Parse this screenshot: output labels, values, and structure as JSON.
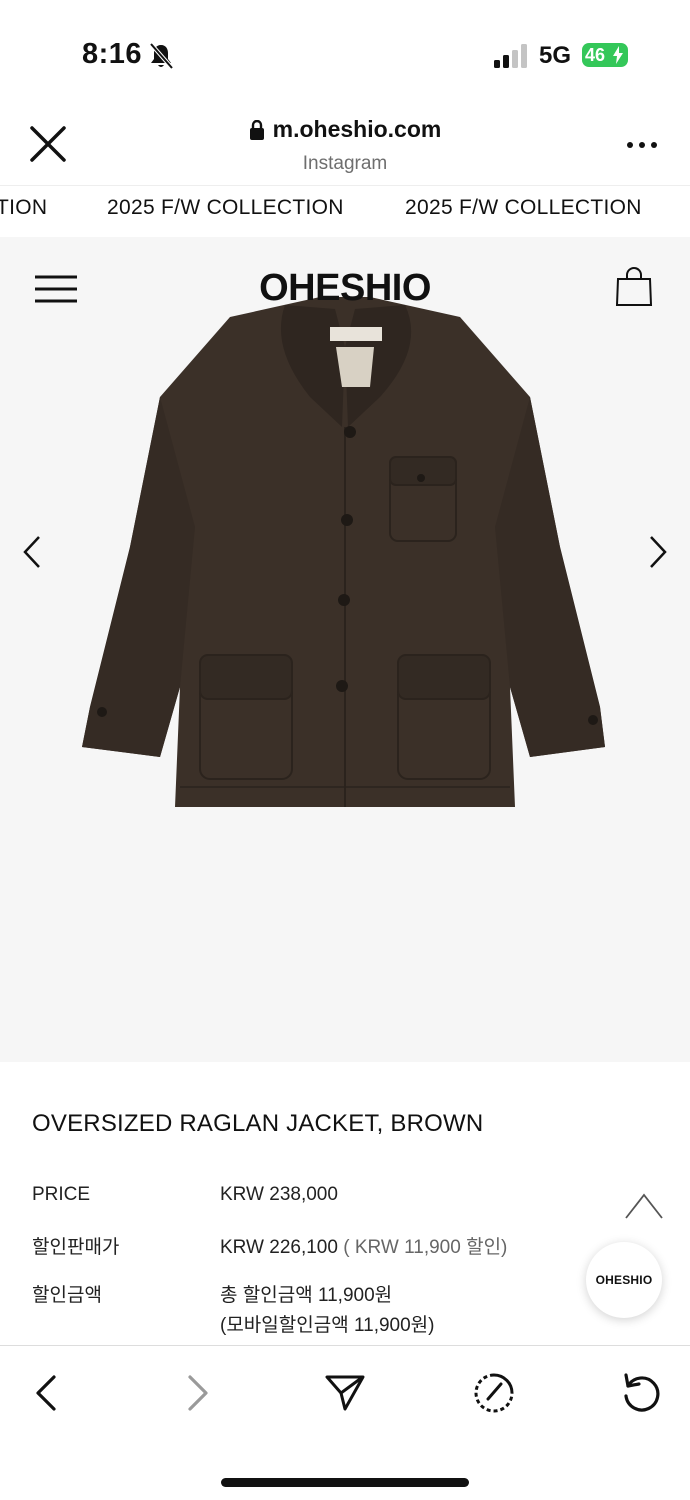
{
  "status_bar": {
    "time": "8:16",
    "network": "5G",
    "battery": "46",
    "icons": [
      "bell-slash-icon",
      "signal-icon",
      "battery-charging-icon"
    ]
  },
  "browser": {
    "url": "m.oheshio.com",
    "source": "Instagram",
    "icons": [
      "close-icon",
      "lock-icon",
      "more-icon"
    ]
  },
  "marquee": {
    "items": [
      "TION",
      "2025 F/W COLLECTION",
      "2025 F/W COLLECTION"
    ]
  },
  "site_header": {
    "brand": "OHESHIO",
    "icons": [
      "hamburger-menu-icon",
      "shopping-bag-icon"
    ]
  },
  "gallery": {
    "icons": [
      "chevron-left-icon",
      "chevron-right-icon"
    ],
    "background": "#f6f6f6",
    "jacket_color": "#3b3028"
  },
  "product": {
    "title": "OVERSIZED RAGLAN JACKET, BROWN",
    "price_label": "PRICE",
    "price_value": "KRW 238,000",
    "sale_label": "할인판매가",
    "sale_value": "KRW 226,100",
    "sale_note": "( KRW 11,900 할인)",
    "discount_label": "할인금액",
    "discount_total": "총 할인금액 11,900원",
    "discount_mobile": "(모바일할인금액 11,900원)"
  },
  "floating": {
    "brand_chip": "OHESHIO",
    "icons": [
      "chevron-up-icon"
    ]
  },
  "toolbar": {
    "icons": [
      "back-icon",
      "forward-icon",
      "share-icon",
      "compass-icon",
      "reload-icon"
    ]
  }
}
